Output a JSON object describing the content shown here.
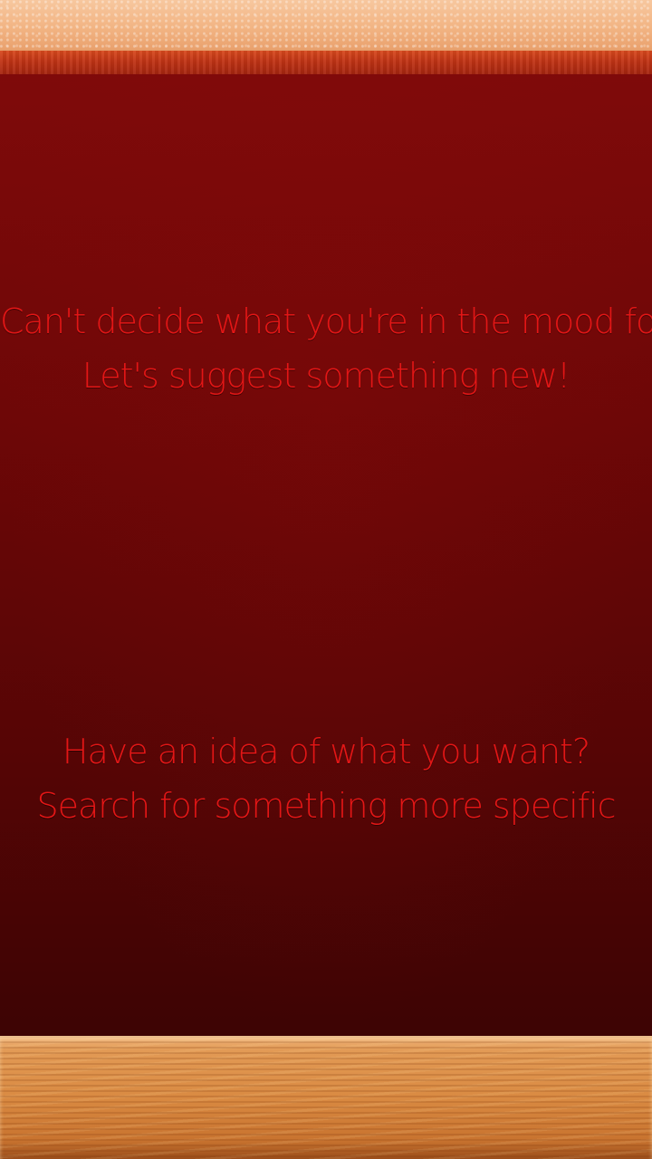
{
  "suggest": {
    "line1": "Can't decide what you're in the mood for?",
    "line2": "Let's suggest something new!"
  },
  "search": {
    "line1": "Have an idea of what you want?",
    "line2": "Search for something more specific"
  },
  "colors": {
    "board": "#6e0707",
    "text": "#e31616",
    "top_strip": "#f2b483",
    "top_border": "#c13415",
    "wood": "#d98a42"
  }
}
